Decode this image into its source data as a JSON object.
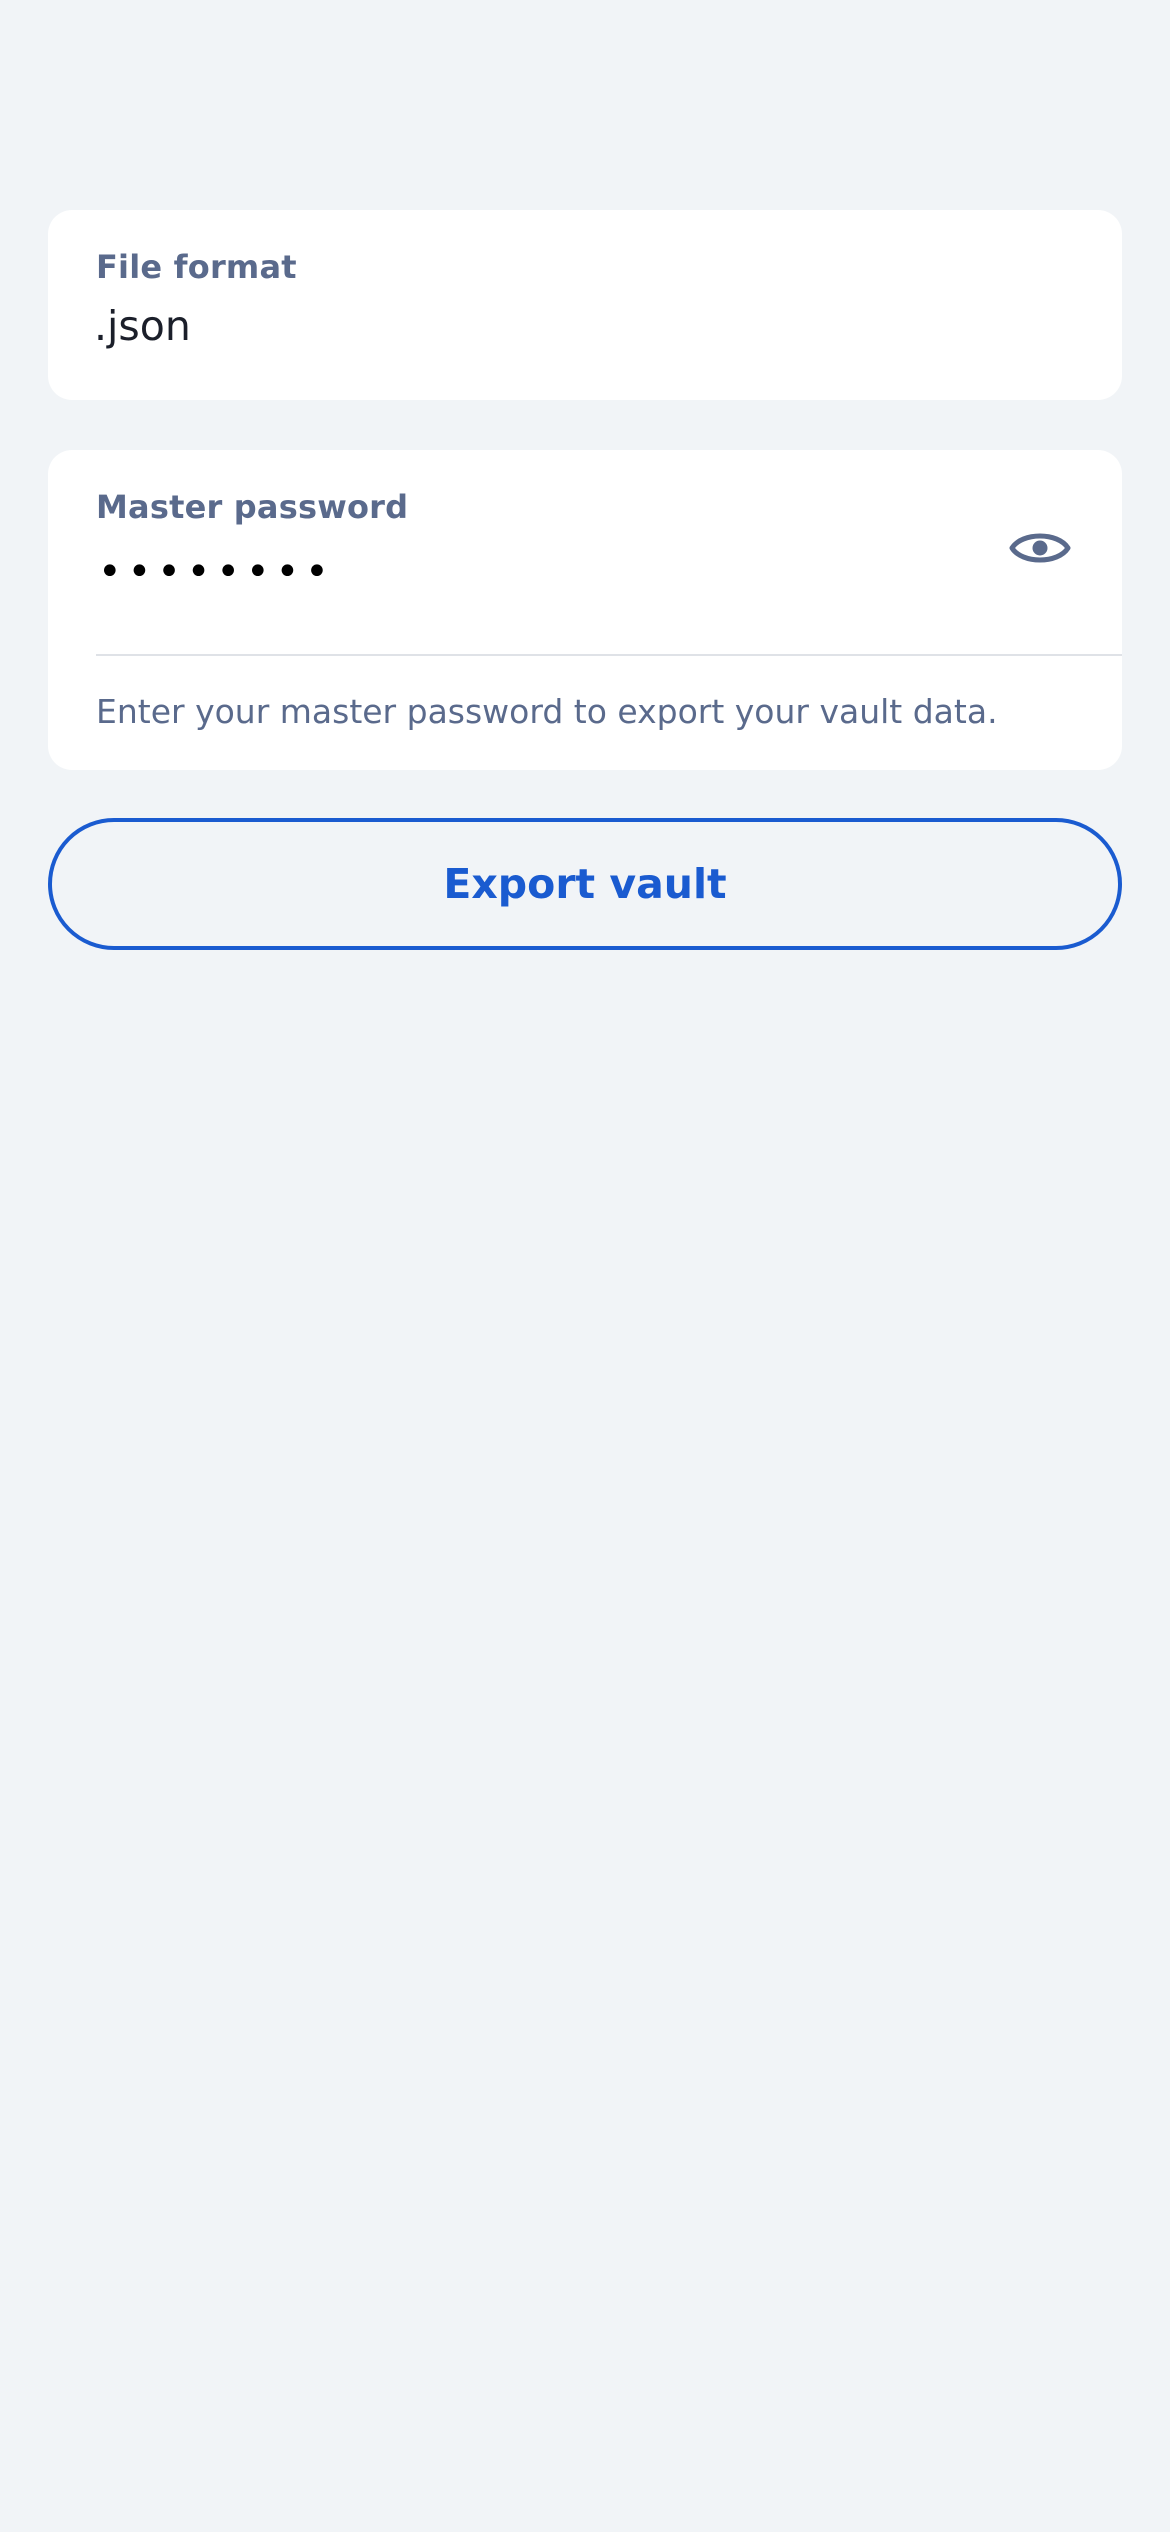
{
  "file_format": {
    "label": "File format",
    "value": ".json"
  },
  "master_password": {
    "label": "Master password",
    "masked_value": "••••••••",
    "toggle_icon": "eye-icon",
    "helper_text": "Enter your master password to export your vault data."
  },
  "actions": {
    "export_label": "Export vault"
  },
  "colors": {
    "background": "#f1f4f7",
    "label": "#5a6a8c",
    "accent": "#1a5bd0"
  }
}
